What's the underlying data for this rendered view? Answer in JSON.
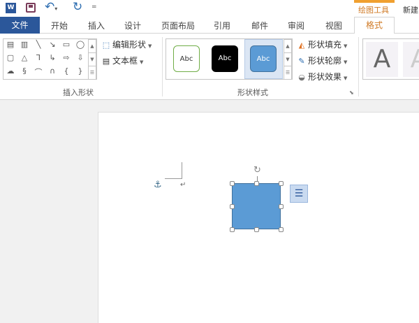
{
  "quick_access": {
    "word_icon": "W",
    "save_icon": "save-icon",
    "undo_icon": "undo-icon",
    "redo_icon": "redo-icon",
    "customize": "="
  },
  "context": {
    "group_label": "绘图工具",
    "doc_title": "新建"
  },
  "tabs": [
    "文件",
    "开始",
    "插入",
    "设计",
    "页面布局",
    "引用",
    "邮件",
    "审阅",
    "视图",
    "格式"
  ],
  "insert_shapes": {
    "edit_shape": "编辑形状",
    "text_box": "文本框",
    "label": "插入形状"
  },
  "shape_styles": {
    "thumbs": [
      "Abc",
      "Abc",
      "Abc"
    ],
    "fill": "形状填充",
    "outline": "形状轮廓",
    "effects": "形状效果",
    "label": "形状样式"
  },
  "wordart": {
    "letters": [
      "A",
      "A"
    ]
  },
  "document": {
    "paragraph_mark": "↵"
  },
  "colors": {
    "file_tab": "#2b579a",
    "accent": "#d07a25",
    "shape_fill": "#5b9bd5",
    "shape_border": "#41719c"
  }
}
